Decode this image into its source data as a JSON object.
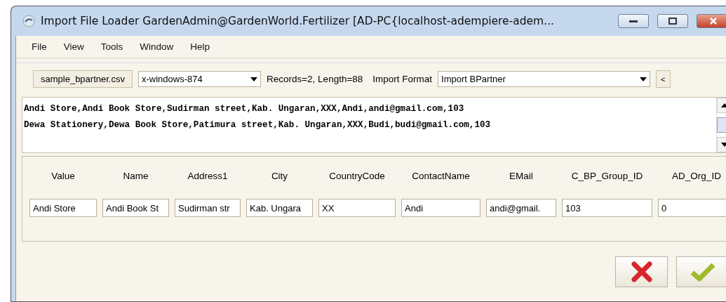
{
  "window": {
    "title": "Import File Loader  GardenAdmin@GardenWorld.Fertilizer [AD-PC{localhost-adempiere-adem..."
  },
  "menu": [
    "File",
    "View",
    "Tools",
    "Window",
    "Help"
  ],
  "toolbar": {
    "file_button": "sample_bpartner.csv",
    "charset": "x-windows-874",
    "info": "Records=2, Length=88",
    "format_label": "Import Format",
    "format": "Import BPartner",
    "collapse_button": "<"
  },
  "file_lines": [
    "Andi Store,Andi Book Store,Sudirman street,Kab. Ungaran,XXX,Andi,andi@gmail.com,103",
    "Dewa Stationery,Dewa Book Store,Patimura street,Kab. Ungaran,XXX,Budi,budi@gmail.com,103"
  ],
  "fields": [
    {
      "label": "Value",
      "value": "Andi Store"
    },
    {
      "label": "Name",
      "value": "Andi Book St"
    },
    {
      "label": "Address1",
      "value": "Sudirman str"
    },
    {
      "label": "City",
      "value": "Kab. Ungara"
    },
    {
      "label": "CountryCode",
      "value": "XX"
    },
    {
      "label": "ContactName",
      "value": "Andi"
    },
    {
      "label": "EMail",
      "value": "andi@gmail."
    },
    {
      "label": "C_BP_Group_ID",
      "value": "103"
    },
    {
      "label": "AD_Org_ID",
      "value": "0"
    }
  ]
}
